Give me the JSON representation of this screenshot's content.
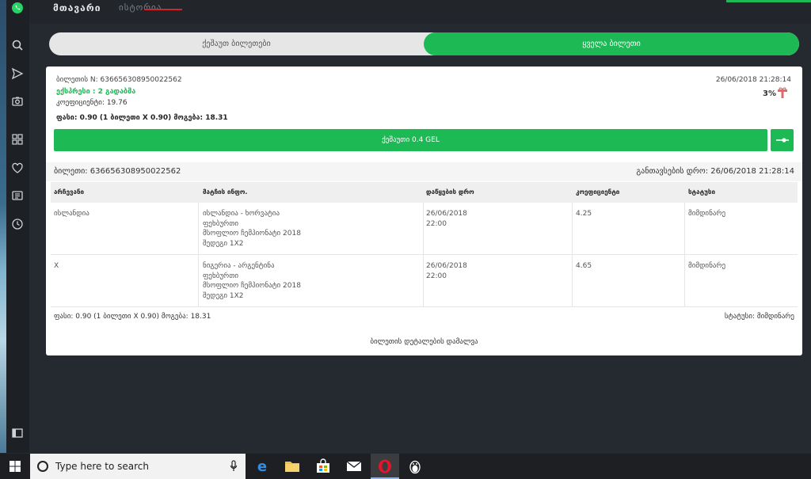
{
  "app": {
    "tab_primary": "მთავარი",
    "tab_secondary": "ისტორია"
  },
  "toggle": {
    "left_label": "ქეშაუთ ბილეთები",
    "right_label": "ყველა ბილეთი"
  },
  "ticket": {
    "number_label": "ბილეთის N: 636656308950022562",
    "date": "26/06/2018 21:28:14",
    "express": "ექსპრესი : 2 გადაბმა",
    "coefficient": "კოეფიციენტი: 19.76",
    "percent": "3%",
    "price_line": "ფასი: 0.90 (1 ბილეთი X 0.90)  მოგება: 18.31",
    "cashout_label": "ქეშაუთი 0.4 GEL"
  },
  "details": {
    "ticket": "ბილეთი: 636656308950022562",
    "register_time": "განთავსების დრო: 26/06/2018 21:28:14",
    "columns": [
      "არჩევანი",
      "მატჩის ინფო.",
      "დაწყების დრო",
      "კოეფიციენტი",
      "სტატუსი"
    ],
    "rows": [
      {
        "choice": "ისლანდია",
        "match": [
          "ისლანდია - ხორვატია",
          "ფეხბურთი",
          "მსოფლიო ჩემპიონატი 2018",
          "შედეგი 1X2"
        ],
        "start": [
          "26/06/2018",
          "22:00"
        ],
        "coef": "4.25",
        "status": "მიმდინარე"
      },
      {
        "choice": "X",
        "match": [
          "ნიგერია - არგენტინა",
          "ფეხბურთი",
          "მსოფლიო ჩემპიონატი 2018",
          "შედეგი 1X2"
        ],
        "start": [
          "26/06/2018",
          "22:00"
        ],
        "coef": "4.65",
        "status": "მიმდინარე"
      }
    ],
    "footer_price": "ფასი: 0.90 (1 ბილეთი X 0.90) მოგება: 18.31",
    "footer_status": "სტატუსი: მიმდინარე",
    "hide_label": "ბილეთის დეტალების დამალვა"
  },
  "taskbar": {
    "search_placeholder": "Type here to search"
  },
  "colors": {
    "accent": "#1db954",
    "background": "#252a31",
    "sidebar": "#1d2024"
  },
  "icons": {
    "sidebar": [
      "whatsapp-icon",
      "search-icon",
      "send-icon",
      "camera-icon",
      "grid-icon",
      "heart-icon",
      "news-icon",
      "history-icon",
      "sidebar-toggle-icon"
    ],
    "taskbar": [
      "windows-icon",
      "edge-icon",
      "file-explorer-icon",
      "store-icon",
      "mail-icon",
      "opera-icon",
      "app-icon"
    ]
  }
}
